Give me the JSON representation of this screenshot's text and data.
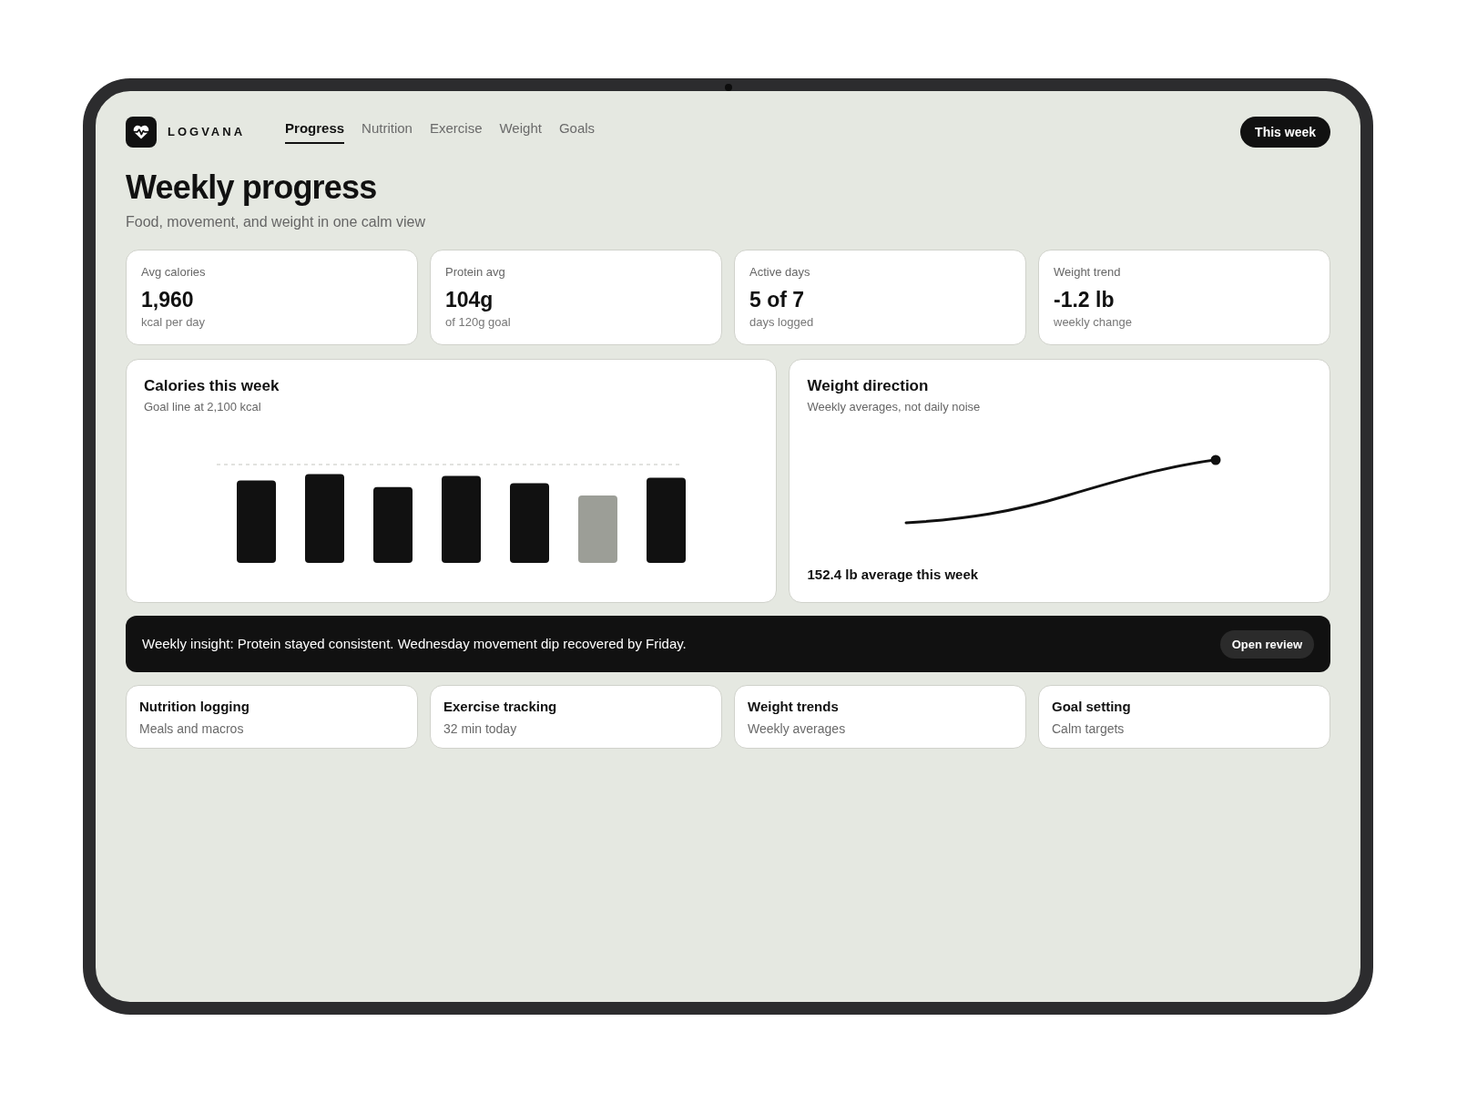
{
  "brand": {
    "name": "LOGVANA"
  },
  "nav": {
    "tabs": [
      {
        "label": "Progress",
        "selected": true
      },
      {
        "label": "Nutrition",
        "selected": false
      },
      {
        "label": "Exercise",
        "selected": false
      },
      {
        "label": "Weight",
        "selected": false
      },
      {
        "label": "Goals",
        "selected": false
      }
    ]
  },
  "period_button": {
    "label": "This week"
  },
  "page": {
    "title": "Weekly progress",
    "subtitle": "Food, movement, and weight in one calm view"
  },
  "stats": [
    {
      "label": "Avg calories",
      "value": "1,960",
      "note": "kcal per day"
    },
    {
      "label": "Protein avg",
      "value": "104g",
      "note": "of 120g goal"
    },
    {
      "label": "Active days",
      "value": "5 of 7",
      "note": "days logged"
    },
    {
      "label": "Weight trend",
      "value": "-1.2 lb",
      "note": "weekly change"
    }
  ],
  "calories_card": {
    "title": "Calories this week",
    "subtitle": "Goal line at 2,100 kcal"
  },
  "weight_card": {
    "title": "Weight direction",
    "subtitle": "Weekly averages, not daily noise",
    "summary": "152.4 lb average this week"
  },
  "insight": {
    "text": "Weekly insight: Protein stayed consistent. Wednesday movement dip recovered by Friday.",
    "button": "Open review"
  },
  "shortcuts": [
    {
      "title": "Nutrition logging",
      "subtitle": "Meals and macros"
    },
    {
      "title": "Exercise tracking",
      "subtitle": "32 min today"
    },
    {
      "title": "Weight trends",
      "subtitle": "Weekly averages"
    },
    {
      "title": "Goal setting",
      "subtitle": "Calm targets"
    }
  ]
}
